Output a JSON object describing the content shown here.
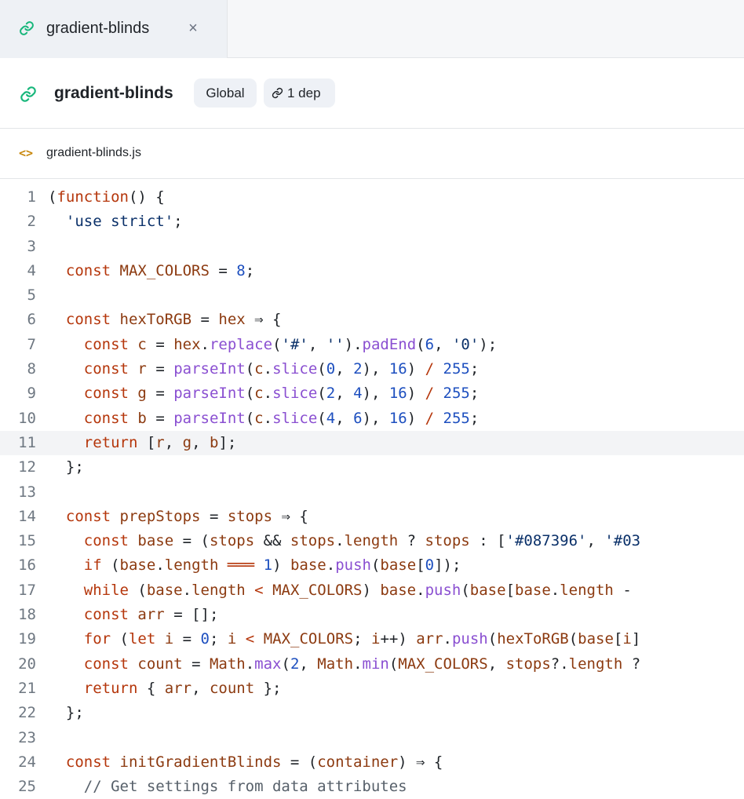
{
  "tab": {
    "label": "gradient-blinds",
    "close_glyph": "×",
    "icon": "link-icon"
  },
  "header": {
    "title": "gradient-blinds",
    "icon": "link-icon",
    "badges": {
      "scope": "Global",
      "deps": "1 dep"
    }
  },
  "file": {
    "icon_glyph": "<>",
    "name": "gradient-blinds.js"
  },
  "colors": {
    "keyword": "#b5360b",
    "number": "#1d4fbf",
    "string": "#0a3069",
    "identifier": "#8c3a10",
    "method": "#8a4fd1",
    "comment": "#57606a",
    "link_icon": "#16b67a",
    "file_icon": "#c8870b"
  },
  "editor": {
    "active_line": 11,
    "lines": [
      "(function() {",
      "  'use strict';",
      "",
      "  const MAX_COLORS = 8;",
      "",
      "  const hexToRGB = hex ⇒ {",
      "    const c = hex.replace('#', '').padEnd(6, '0');",
      "    const r = parseInt(c.slice(0, 2), 16) / 255;",
      "    const g = parseInt(c.slice(2, 4), 16) / 255;",
      "    const b = parseInt(c.slice(4, 6), 16) / 255;",
      "    return [r, g, b];",
      "  };",
      "",
      "  const prepStops = stops ⇒ {",
      "    const base = (stops && stops.length ? stops : ['#087396', '#03",
      "    if (base.length ═══ 1) base.push(base[0]);",
      "    while (base.length < MAX_COLORS) base.push(base[base.length -",
      "    const arr = [];",
      "    for (let i = 0; i < MAX_COLORS; i++) arr.push(hexToRGB(base[i]",
      "    const count = Math.max(2, Math.min(MAX_COLORS, stops?.length ?",
      "    return { arr, count };",
      "  };",
      "",
      "  const initGradientBlinds = (container) ⇒ {",
      "    // Get settings from data attributes"
    ]
  }
}
